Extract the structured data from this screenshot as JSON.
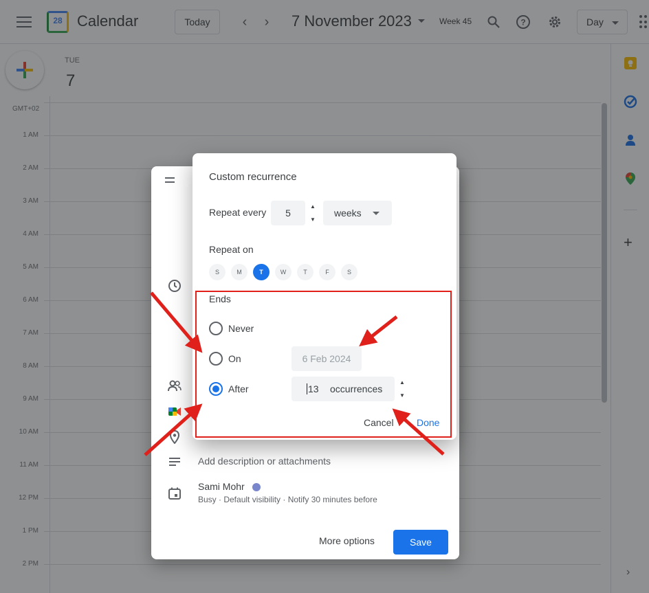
{
  "header": {
    "app_title": "Calendar",
    "logo_date": "28",
    "today_label": "Today",
    "date_title": "7 November 2023",
    "week_label": "Week 45",
    "view_label": "Day"
  },
  "day_column": {
    "day_name": "TUE",
    "day_number": "7",
    "timezone": "GMT+02",
    "hours": [
      "1 AM",
      "2 AM",
      "3 AM",
      "4 AM",
      "5 AM",
      "6 AM",
      "7 AM",
      "8 AM",
      "9 AM",
      "10 AM",
      "11 AM",
      "12 PM",
      "1 PM",
      "2 PM"
    ]
  },
  "event_dialog": {
    "description_placeholder": "Add description or attachments",
    "owner": "Sami Mohr",
    "owner_meta": "Busy · Default visibility · Notify 30 minutes before",
    "more_options_label": "More options",
    "save_label": "Save"
  },
  "recurrence_dialog": {
    "title": "Custom recurrence",
    "repeat_every_label": "Repeat every",
    "repeat_count": "5",
    "repeat_unit": "weeks",
    "repeat_on_label": "Repeat on",
    "weekdays": [
      "S",
      "M",
      "T",
      "W",
      "T",
      "F",
      "S"
    ],
    "selected_weekday_index": 2,
    "ends_label": "Ends",
    "options": {
      "never": "Never",
      "on": "On",
      "after": "After"
    },
    "selected_end_option": "after",
    "on_date": "6 Feb 2024",
    "occurrences_value": "13",
    "occurrences_unit": "occurrences",
    "cancel_label": "Cancel",
    "done_label": "Done"
  },
  "colors": {
    "accent": "#1a73e8",
    "annotation": "#e0201a",
    "overlay": "rgba(32,33,36,0.5)"
  },
  "icons": {
    "side_panel": [
      "keep-icon",
      "tasks-icon",
      "contacts-icon",
      "maps-icon",
      "add-icon"
    ],
    "header": [
      "menu-icon",
      "search-icon",
      "help-icon",
      "settings-icon",
      "apps-icon"
    ]
  }
}
